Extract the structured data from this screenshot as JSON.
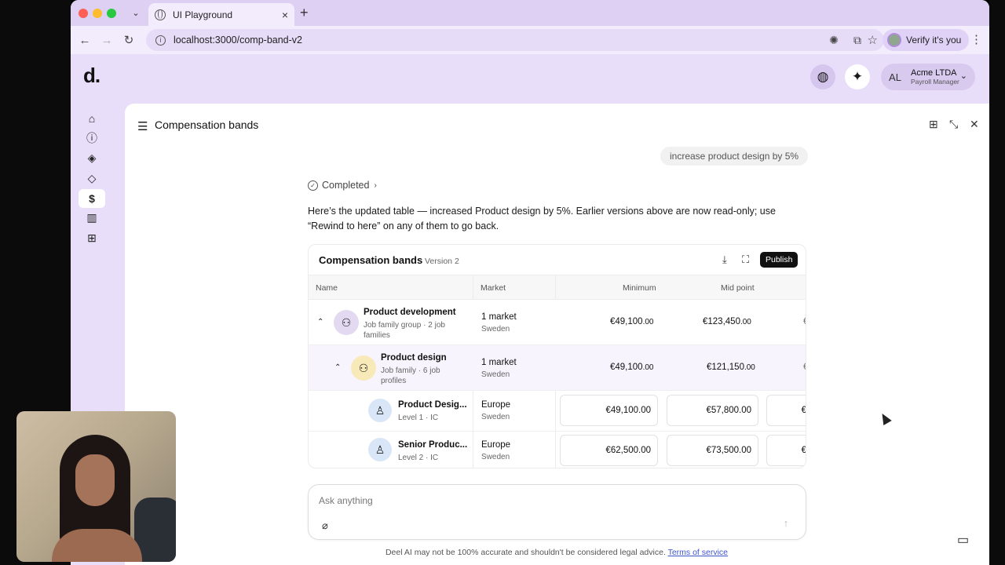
{
  "browser": {
    "tab_title": "UI Playground",
    "url": "localhost:3000/comp-band-v2",
    "verify_label": "Verify it's you",
    "tab_close": "×",
    "new_tab": "+"
  },
  "app": {
    "logo": "d.",
    "account": {
      "initials": "AL",
      "name": "Acme LTDA",
      "role": "Payroll Manager"
    }
  },
  "panel": {
    "title": "Compensation bands"
  },
  "chat": {
    "user_message": "increase product design by 5%",
    "status": "Completed",
    "assistant_message": "Here’s the updated table — increased Product design by 5%. Earlier versions above are now read-only; use “Rewind to here” on any of them to go back."
  },
  "table": {
    "title": "Compensation bands",
    "version": "Version 2",
    "publish_label": "Publish",
    "columns": {
      "name": "Name",
      "market": "Market",
      "minimum": "Minimum",
      "midpoint": "Mid point"
    },
    "rows": [
      {
        "name": "Product development",
        "sub": "Job family group · 2 job families",
        "market": "1 market",
        "market_sub": "Sweden",
        "min_main": "€49,100",
        "min_dec": ".00",
        "mid_main": "€123,450",
        "mid_dec": ".00",
        "clip": "€"
      },
      {
        "name": "Product design",
        "sub": "Job family · 6 job profiles",
        "market": "1 market",
        "market_sub": "Sweden",
        "min_main": "€49,100",
        "min_dec": ".00",
        "mid_main": "€121,150",
        "mid_dec": ".00",
        "clip": "€"
      },
      {
        "name": "Product Desig...",
        "sub": "Level 1 · IC",
        "market": "Europe",
        "market_sub": "Sweden",
        "min": "€49,100.00",
        "mid": "€57,800.00",
        "clip": "€"
      },
      {
        "name": "Senior Produc...",
        "sub": "Level 2 · IC",
        "market": "Europe",
        "market_sub": "Sweden",
        "min": "€62,500.00",
        "mid": "€73,500.00",
        "clip": "€"
      }
    ]
  },
  "composer": {
    "placeholder": "Ask anything"
  },
  "footer": {
    "disclaimer": "Deel AI may not be 100% accurate and shouldn't be considered legal advice.",
    "terms_link": "Terms of service"
  }
}
